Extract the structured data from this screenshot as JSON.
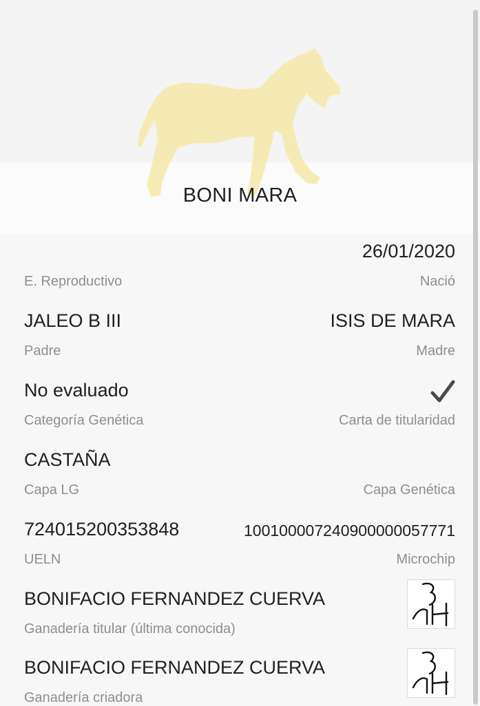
{
  "horse": {
    "name": "BONI MARA"
  },
  "fields": {
    "birth_date": "26/01/2020",
    "reproductive_state_label": "E. Reproductivo",
    "birth_label": "Nació",
    "father": "JALEO B III",
    "father_label": "Padre",
    "mother": "ISIS DE MARA",
    "mother_label": "Madre",
    "genetic_category": "No evaluado",
    "genetic_category_label": "Categoría Genética",
    "title_card_icon": "checkmark-icon",
    "title_card_label": "Carta de titularidad",
    "coat_lg": "CASTAÑA",
    "coat_lg_label": "Capa LG",
    "genetic_coat_label": "Capa Genética",
    "ueln": "724015200353848",
    "ueln_label": "UELN",
    "microchip": "100100007240900000057771",
    "microchip_label": "Microchip",
    "owner_farm": "BONIFACIO FERNANDEZ CUERVA",
    "owner_farm_label": "Ganadería titular (última conocida)",
    "breeder_farm": "BONIFACIO FERNANDEZ CUERVA",
    "breeder_farm_label": "Ganadería criadora"
  },
  "colors": {
    "horse_silhouette": "#f6e7a8",
    "value_text": "#202020",
    "label_text": "#8e8e8e"
  }
}
